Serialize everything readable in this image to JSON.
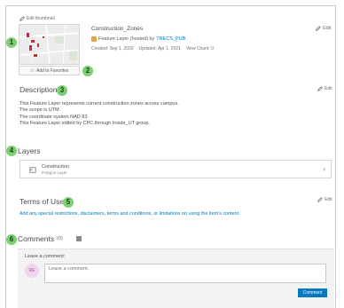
{
  "item": {
    "edit_thumbnail_label": "Edit thumbnail",
    "title": "Construction_Zones",
    "type_text": "Feature Layer (hosted) by",
    "owner": "TRECS_PUB",
    "created": "Created: Sep 1, 2020",
    "updated": "Updated: Apr 1, 2021",
    "view_count": "View Count: 0",
    "add_favorites_label": "Add to Favorites",
    "edit_label": "Edit"
  },
  "description": {
    "heading": "Description",
    "edit_label": "Edit",
    "lines": [
      "This Feature Layer represents current construction zones across campus.",
      "The scope is UTM.",
      "The coordinate system NAD 83.",
      "This Feature Layer edited by CPC through Inside_UT group."
    ]
  },
  "layers": {
    "heading": "Layers",
    "items": [
      {
        "name": "Construction",
        "type": "Polygon Layer"
      }
    ]
  },
  "terms": {
    "heading": "Terms of Use",
    "edit_label": "Edit",
    "link_text": "Add any special restrictions, disclaimers, terms and conditions, or limitations on using the item's content."
  },
  "comments": {
    "heading": "Comments",
    "count": "(0)",
    "leave_label": "Leave a comment:",
    "avatar_initials": "RE",
    "placeholder": "Leave a comment.",
    "submit_label": "Comment"
  },
  "badges": [
    "1",
    "2",
    "3",
    "4",
    "5",
    "6"
  ],
  "colors": {
    "badge": "#7ccf73",
    "link": "#0079c1",
    "button": "#0079c1",
    "avatar": "#f1d5ee"
  }
}
